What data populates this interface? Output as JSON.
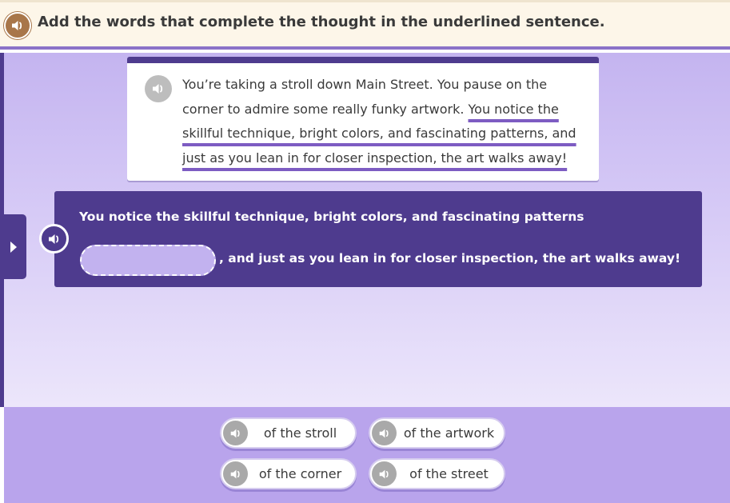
{
  "header": {
    "instruction": "Add the words that complete the thought in the underlined sentence.",
    "audio_icon": "speaker-icon"
  },
  "passage": {
    "plain_text": "You’re taking a stroll down Main Street. You pause on the corner to admire some really funky artwork. ",
    "underlined_text": "You notice the skillful technique, bright colors, and fascinating patterns, and just as you lean in for closer inspection, the art walks away!"
  },
  "builder": {
    "line1": "You notice the skillful technique, bright colors, and fascinating patterns",
    "line2": ", and just as you lean in for closer inspection, the art walks away!"
  },
  "choices": [
    {
      "label": "of the stroll"
    },
    {
      "label": "of the artwork"
    },
    {
      "label": "of the corner"
    },
    {
      "label": "of the street"
    }
  ],
  "colors": {
    "accent": "#4e3b8e",
    "header_bg": "#fdf6e9",
    "header_audio": "#a8764a",
    "underline": "#7d5cc2"
  }
}
